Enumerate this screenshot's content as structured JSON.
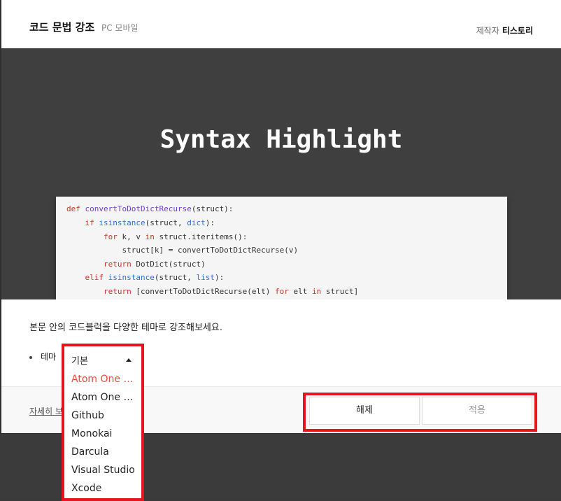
{
  "header": {
    "title": "코드 문법 강조",
    "subtitle": "PC 모바일",
    "maker_label": "제작자",
    "maker_name": "티스토리"
  },
  "preview": {
    "hero_text": "Syntax Highlight",
    "code_lines": [
      "def convertToDotDictRecurse(struct):",
      "    if isinstance(struct, dict):",
      "        for k, v in struct.iteritems():",
      "            struct[k] = convertToDotDictRecurse(v)",
      "        return DotDict(struct)",
      "    elif isinstance(struct, list):",
      "        return [convertToDotDictRecurse(elt) for elt in struct]"
    ]
  },
  "description": "본문 안의 코드블럭을 다양한 테마로 강조해보세요.",
  "theme": {
    "label": "테마",
    "selected": "기본",
    "options": [
      "Atom One Dark",
      "Atom One Light",
      "Github",
      "Monokai",
      "Darcula",
      "Visual Studio",
      "Xcode"
    ]
  },
  "footer": {
    "more_link": "자세히 보기",
    "release_label": "해제",
    "apply_label": "적용"
  },
  "colors": {
    "accent": "#e4151f",
    "active_option": "#e84c3d"
  }
}
